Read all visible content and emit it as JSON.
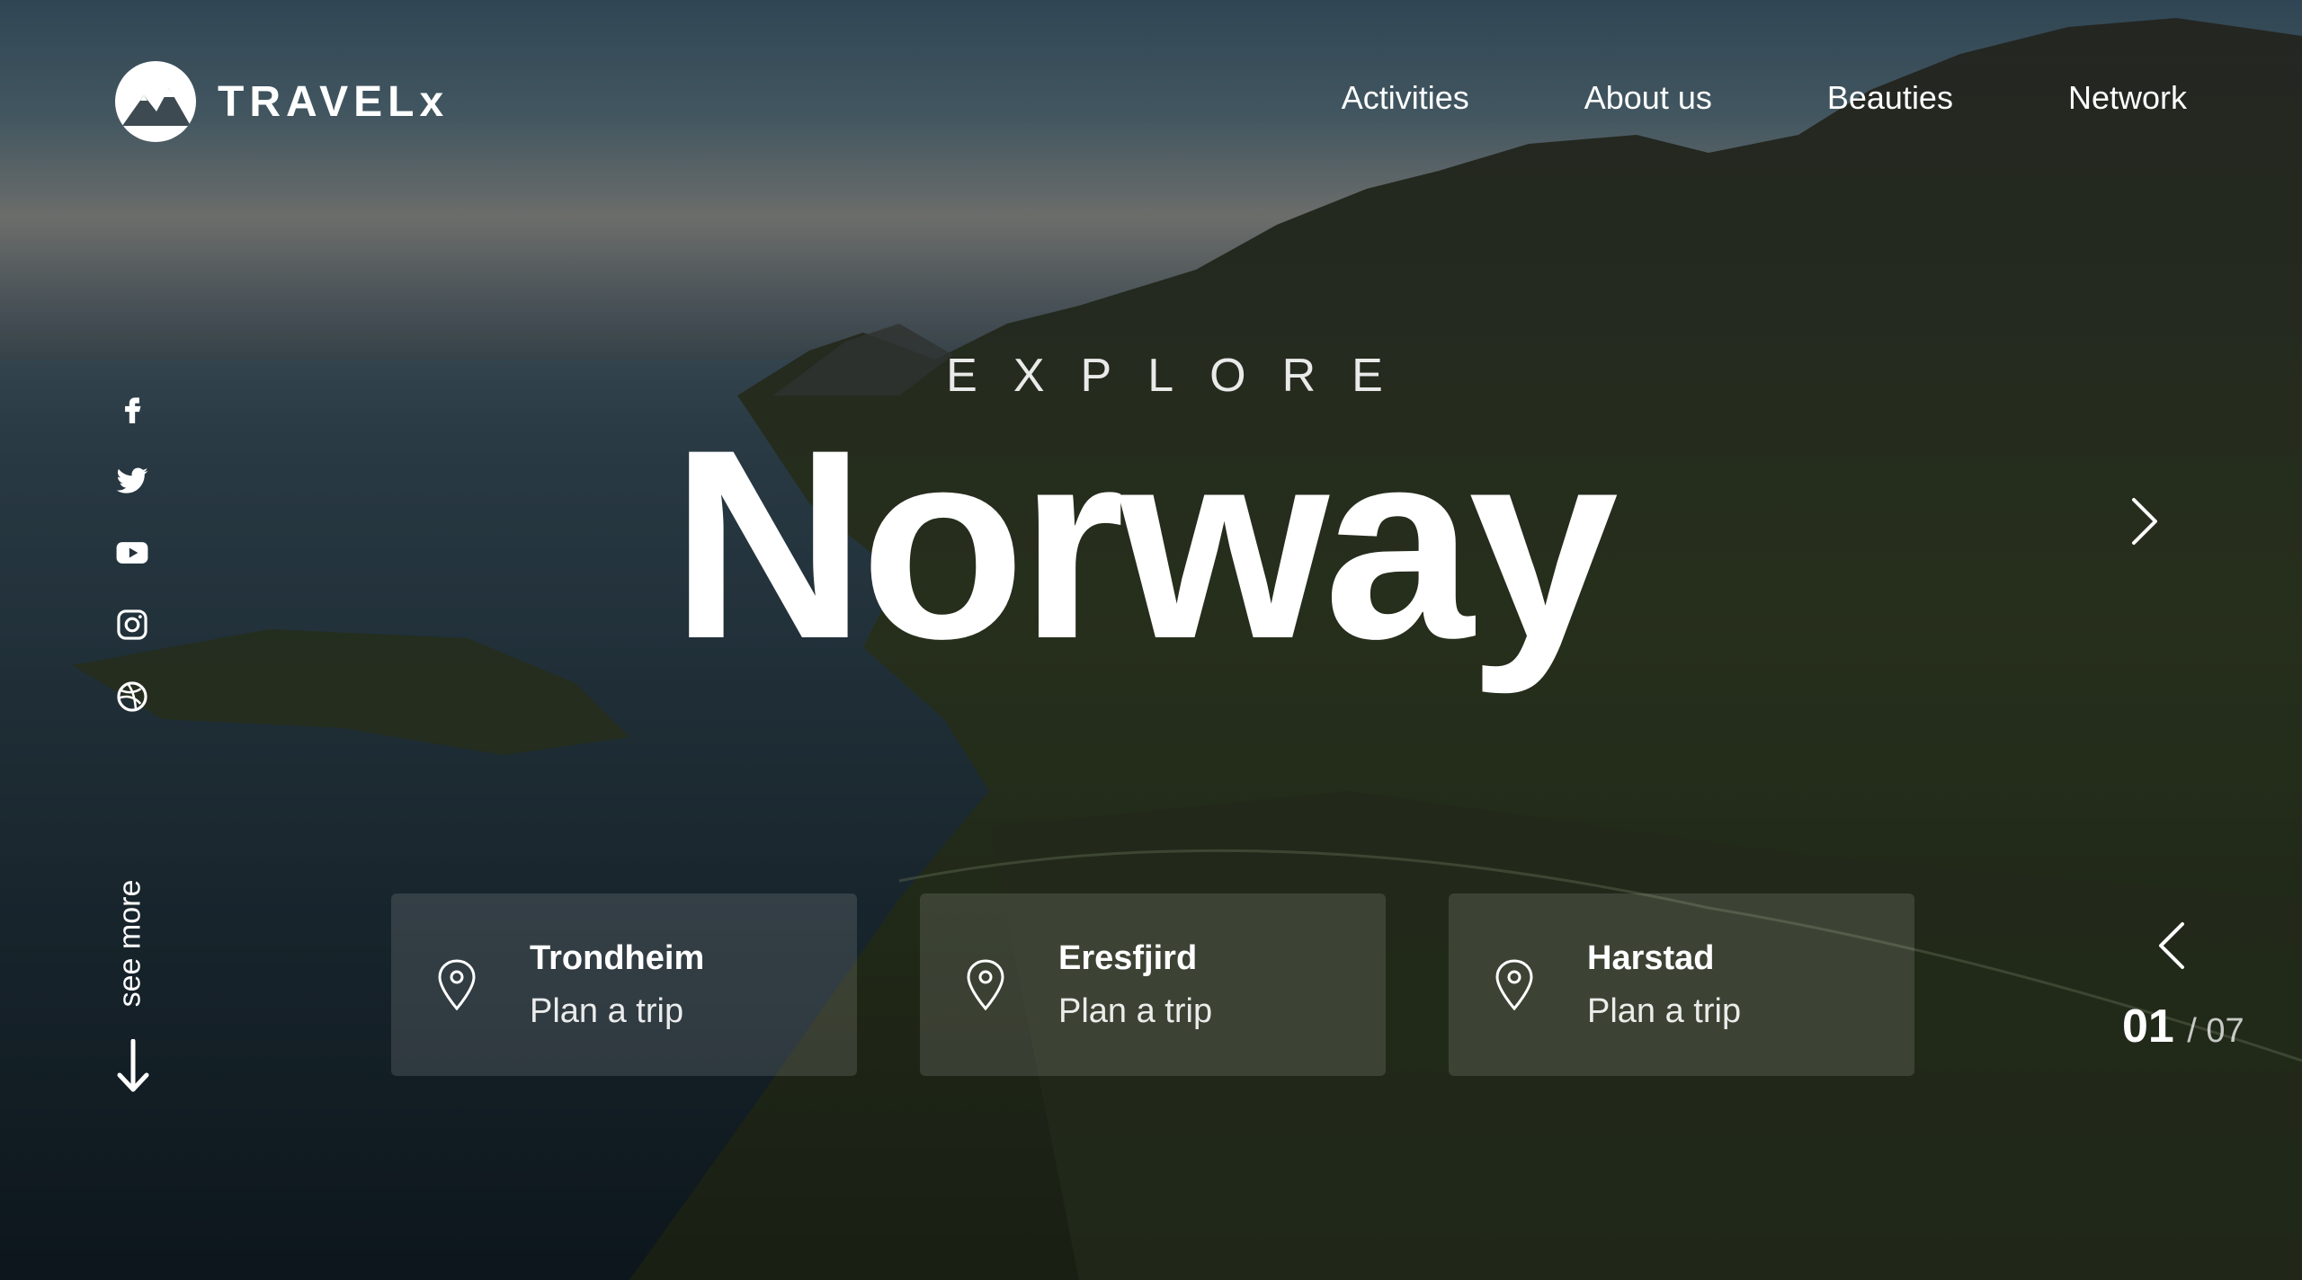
{
  "brand": {
    "name": "TRAVELx"
  },
  "nav": {
    "items": [
      "Activities",
      "About us",
      "Beauties",
      "Network"
    ]
  },
  "social": [
    "facebook-icon",
    "twitter-icon",
    "youtube-icon",
    "instagram-icon",
    "dribbble-icon"
  ],
  "hero": {
    "eyebrow": "EXPLORE",
    "title": "Norway"
  },
  "see_more": {
    "label": "see more"
  },
  "slider": {
    "current": "01",
    "total": "/ 07"
  },
  "cards": [
    {
      "title": "Trondheim",
      "action": "Plan a trip"
    },
    {
      "title": "Eresfjird",
      "action": "Plan a trip"
    },
    {
      "title": "Harstad",
      "action": "Plan a trip"
    }
  ]
}
